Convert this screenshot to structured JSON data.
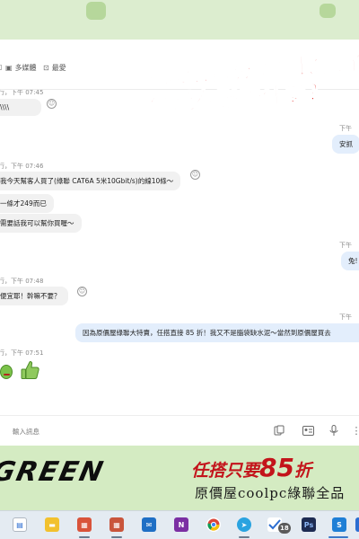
{
  "toolbar": {
    "item1_label": "",
    "item2_label": "多媒體",
    "item3_label": "最愛"
  },
  "overlay": {
    "line1": "就連他都忌妒的比讚了",
    "line2": "你還在猶豫什麼？"
  },
  "messages": [
    {
      "meta": "行，下午 07:45",
      "text": "\\\\\\\\"
    },
    {
      "meta": "下午",
      "text": "安抓"
    },
    {
      "meta": "行，下午 07:46",
      "text": "我今天幫客人買了(綠聯 CAT6A 5米10Gbit/s)的線10條～"
    },
    {
      "text": "一條才249而已"
    },
    {
      "text": "需要話我可以幫你買喔～"
    },
    {
      "meta": "下午",
      "text": "兔!"
    },
    {
      "meta": "行，下午 07:48",
      "text": "便宜耶！幹嘛不要？"
    },
    {
      "meta": "下午",
      "text": "因為原價屋綠聯大特賣，任搭直接 85 折！我又不是腦袋缺水泥～當然到原價屋買去"
    },
    {
      "meta": "行，下午 07:51"
    }
  ],
  "composer": {
    "placeholder": "輸入訊息"
  },
  "banner": {
    "logo": "GREEN",
    "promo_t1": "任搭只要",
    "promo_t2": "85",
    "promo_t3": "折",
    "subtitle": "原價屋coolpc綠聯全品"
  },
  "taskbar": {
    "badge_count": "18"
  },
  "colors": {
    "accent_red": "#e0211e",
    "banner_green": "#d4ebc2",
    "outgoing_bubble": "#e3eefc",
    "incoming_bubble": "#f1f1f1"
  }
}
